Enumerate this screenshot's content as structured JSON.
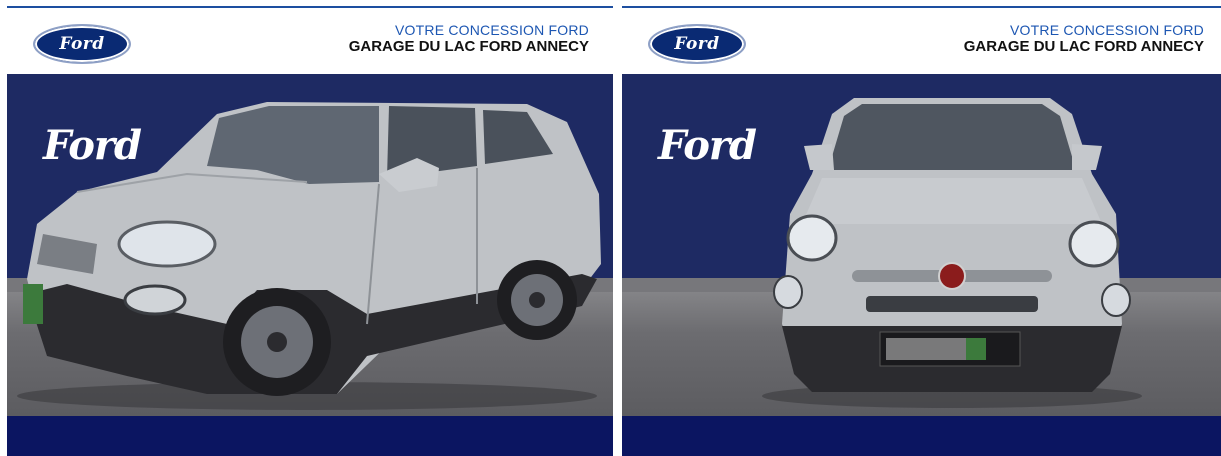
{
  "panels": [
    {
      "id": "left",
      "view": "three-quarter front",
      "header": {
        "tagline": "VOTRE CONCESSION FORD",
        "dealer": "GARAGE DU LAC FORD ANNECY"
      },
      "brand_oval": "Ford",
      "brand_script": "Ford"
    },
    {
      "id": "right",
      "view": "front",
      "header": {
        "tagline": "VOTRE CONCESSION FORD",
        "dealer": "GARAGE DU LAC FORD ANNECY"
      },
      "brand_oval": "Ford",
      "brand_script": "Ford"
    }
  ],
  "colors": {
    "backdrop": "#1e2a63",
    "footer": "#0b1561",
    "accent": "#1c56b2",
    "car_body": "#bfc2c6"
  }
}
